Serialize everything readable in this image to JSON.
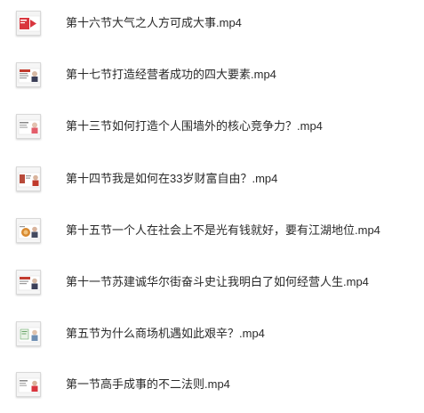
{
  "files": [
    {
      "name": "第十六节大气之人方可成大事.mp4",
      "thumbnail": "video-thumbnail-red-play",
      "accent": "#d9363e"
    },
    {
      "name": "第十七节打造经营者成功的四大要素.mp4",
      "thumbnail": "video-thumbnail-slide-red",
      "accent": "#c23b2e"
    },
    {
      "name": "第十三节如何打造个人围墙外的核心竞争力？.mp4",
      "thumbnail": "video-thumbnail-slide-pink",
      "accent": "#e35d6a"
    },
    {
      "name": "第十四节我是如何在33岁财富自由？.mp4",
      "thumbnail": "video-thumbnail-slide-figure",
      "accent": "#b84a3a"
    },
    {
      "name": "第十五节一个人在社会上不是光有钱就好，要有江湖地位.mp4",
      "thumbnail": "video-thumbnail-slide-orange",
      "accent": "#d8892f"
    },
    {
      "name": "第十一节苏建诚华尔街奋斗史让我明白了如何经营人生.mp4",
      "thumbnail": "video-thumbnail-slide-red",
      "accent": "#c23b2e"
    },
    {
      "name": "第五节为什么商场机遇如此艰辛？.mp4",
      "thumbnail": "video-thumbnail-slide-green",
      "accent": "#6aa56a"
    },
    {
      "name": "第一节高手成事的不二法则.mp4",
      "thumbnail": "video-thumbnail-slide-red",
      "accent": "#d9363e"
    }
  ]
}
